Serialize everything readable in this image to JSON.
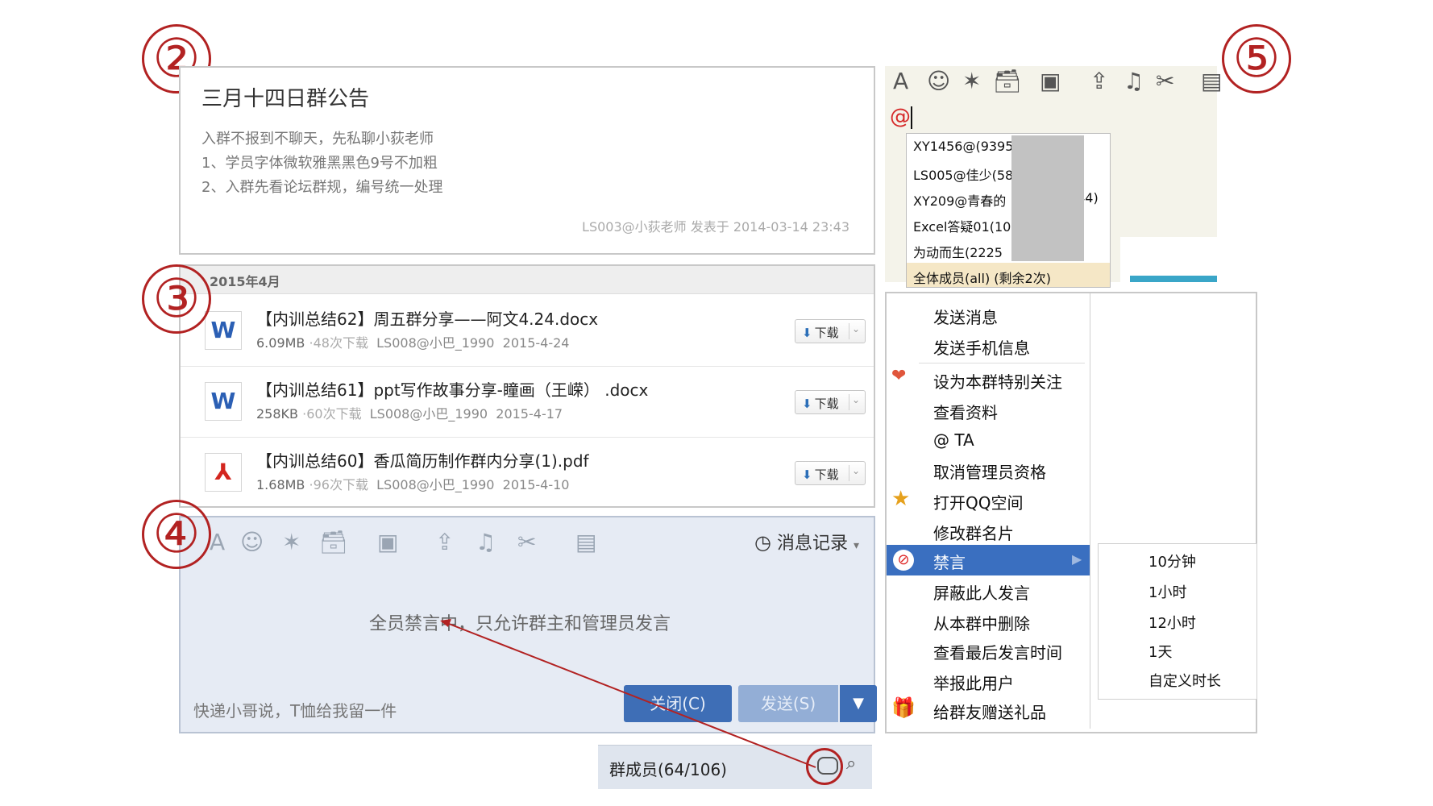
{
  "labels": {
    "c2": "②",
    "c3": "③",
    "c4": "④",
    "c5": "⑤"
  },
  "notice": {
    "title": "三月十四日群公告",
    "lines": [
      "入群不报到不聊天，先私聊小荻老师",
      "1、学员字体微软雅黑黑色9号不加粗",
      "2、入群先看论坛群规，编号统一处理"
    ],
    "footer": "LS003@小荻老师 发表于 2014-03-14 23:43"
  },
  "files": {
    "month": "2015年4月",
    "download_label": "下载",
    "items": [
      {
        "icon": "word-icon",
        "icon_text": "W",
        "name": "【内训总结62】周五群分享——阿文4.24.docx",
        "size": "6.09MB",
        "downloads": "48次下载",
        "uploader": "LS008@小巴_1990",
        "date": "2015-4-24"
      },
      {
        "icon": "word-icon",
        "icon_text": "W",
        "name": "【内训总结61】ppt写作故事分享-瞳画（王嵘） .docx",
        "size": "258KB",
        "downloads": "60次下载",
        "uploader": "LS008@小巴_1990",
        "date": "2015-4-17"
      },
      {
        "icon": "pdf-icon",
        "icon_text": "⅄",
        "name": "【内训总结60】香瓜简历制作群内分享(1).pdf",
        "size": "1.68MB",
        "downloads": "96次下载",
        "uploader": "LS008@小巴_1990",
        "date": "2015-4-10"
      }
    ]
  },
  "input": {
    "history_label": "消息记录",
    "muted_text": "全员禁言中，只允许群主和管理员发言",
    "draft_text": "快递小哥说，T恤给我留一件",
    "close_label": "关闭(C)",
    "send_label": "发送(S)"
  },
  "members": {
    "label": "群成员(64/106)"
  },
  "mention": {
    "at": "@",
    "items": [
      "XY1456@(93959",
      "LS005@佳少(58",
      "XY209@青春的",
      ".44)",
      "Excel答疑01(10",
      "为动而生(2225",
      "全体成员(all) (剩余2次)"
    ]
  },
  "context_menu": {
    "items": [
      "发送消息",
      "发送手机信息",
      "设为本群特别关注",
      "查看资料",
      "@ TA",
      "取消管理员资格",
      "打开QQ空间",
      "修改群名片",
      "禁言",
      "屏蔽此人发言",
      "从本群中删除",
      "查看最后发言时间",
      "举报此用户",
      "给群友赠送礼品"
    ],
    "submenu": [
      "10分钟",
      "1小时",
      "12小时",
      "1天",
      "自定义时长"
    ]
  },
  "colors": {
    "accent": "#b22222",
    "menu_highlight": "#3a6fc0",
    "button_blue": "#3e6eb6"
  }
}
